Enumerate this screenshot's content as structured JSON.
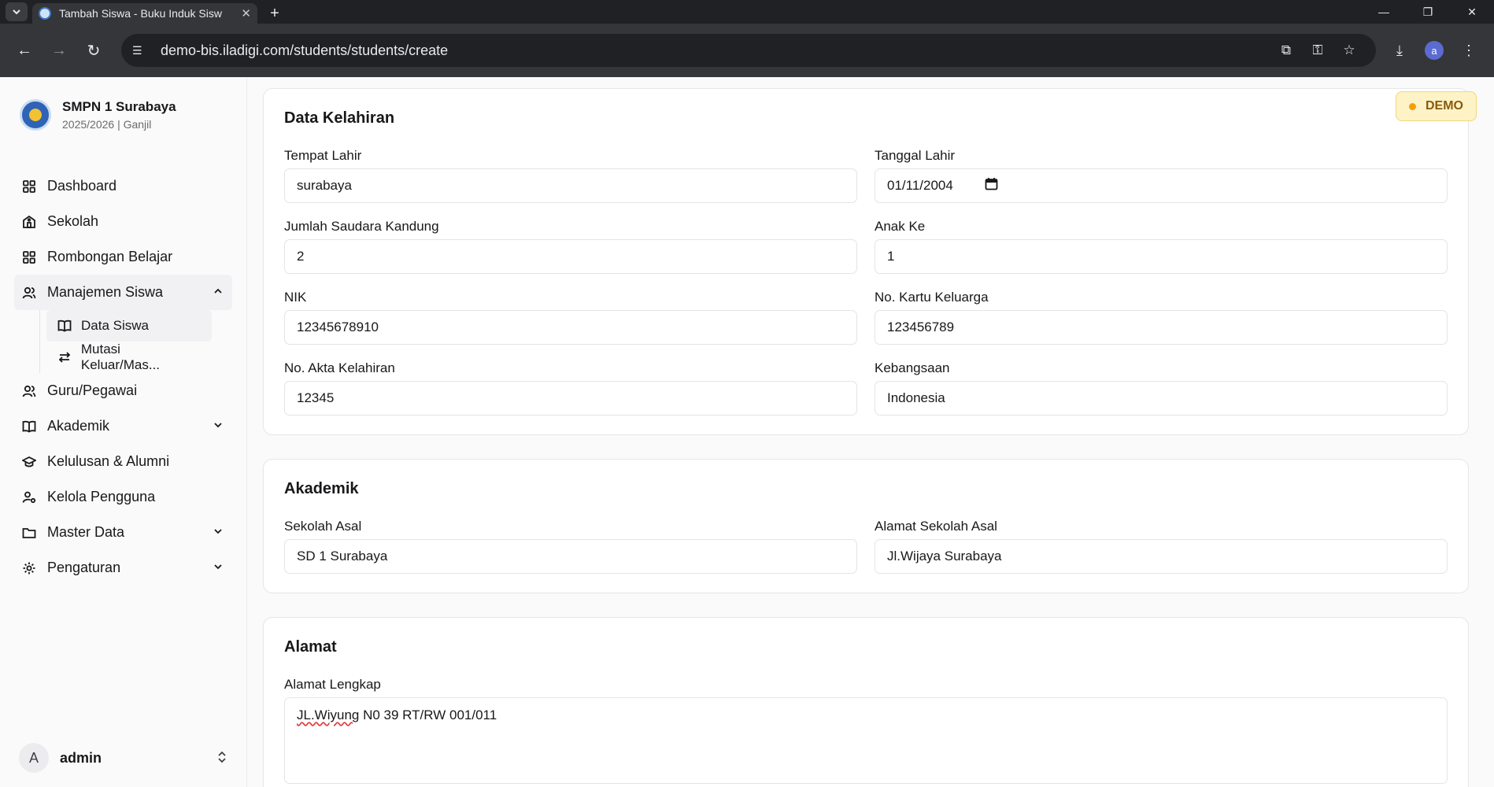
{
  "browser": {
    "tab_title": "Tambah Siswa - Buku Induk Sisw",
    "url": "demo-bis.iladigi.com/students/students/create",
    "profile_initial": "a"
  },
  "school": {
    "name": "SMPN 1 Surabaya",
    "period": "2025/2026 | Ganjil"
  },
  "sidebar": {
    "items": [
      {
        "label": "Dashboard"
      },
      {
        "label": "Sekolah"
      },
      {
        "label": "Rombongan Belajar"
      },
      {
        "label": "Manajemen Siswa"
      },
      {
        "label": "Guru/Pegawai"
      },
      {
        "label": "Akademik"
      },
      {
        "label": "Kelulusan & Alumni"
      },
      {
        "label": "Kelola Pengguna"
      },
      {
        "label": "Master Data"
      },
      {
        "label": "Pengaturan"
      }
    ],
    "sub_items": [
      {
        "label": "Data Siswa"
      },
      {
        "label": "Mutasi Keluar/Mas..."
      }
    ]
  },
  "user": {
    "initial": "A",
    "name": "admin"
  },
  "badge": "DEMO",
  "sections": {
    "kelahiran": {
      "title": "Data Kelahiran",
      "fields": [
        {
          "label": "Tempat Lahir",
          "value": "surabaya"
        },
        {
          "label": "Tanggal Lahir",
          "value": "01/11/2004"
        },
        {
          "label": "Jumlah Saudara Kandung",
          "value": "2"
        },
        {
          "label": "Anak Ke",
          "value": "1"
        },
        {
          "label": "NIK",
          "value": "12345678910"
        },
        {
          "label": "No. Kartu Keluarga",
          "value": "123456789"
        },
        {
          "label": "No. Akta Kelahiran",
          "value": "12345"
        },
        {
          "label": "Kebangsaan",
          "value": "Indonesia"
        }
      ]
    },
    "akademik": {
      "title": "Akademik",
      "fields": [
        {
          "label": "Sekolah Asal",
          "value": "SD 1 Surabaya"
        },
        {
          "label": "Alamat Sekolah Asal",
          "value": "Jl.Wijaya Surabaya"
        }
      ]
    },
    "alamat": {
      "title": "Alamat",
      "fields": [
        {
          "label": "Alamat Lengkap",
          "value_word": "JL.Wiyung",
          "value_rest": " N0 39 RT/RW 001/011"
        }
      ]
    }
  }
}
